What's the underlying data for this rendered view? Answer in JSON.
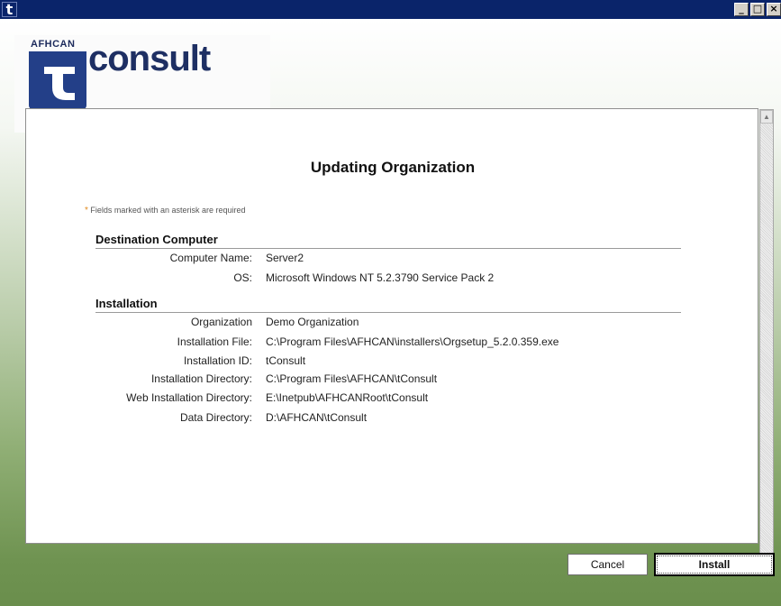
{
  "window": {
    "min_label": "_",
    "max_label": "□",
    "close_label": "×",
    "app_icon_label": "t"
  },
  "logo": {
    "brand": "AFHCAN",
    "product": "consult"
  },
  "page": {
    "title": "Updating Organization",
    "required_star": "*",
    "required_note": "Fields marked with an asterisk are required"
  },
  "destination": {
    "title": "Destination Computer",
    "rows": [
      {
        "label": "Computer Name:",
        "value": "Server2"
      },
      {
        "label": "OS:",
        "value": "Microsoft Windows NT 5.2.3790 Service Pack 2"
      }
    ]
  },
  "installation": {
    "title": "Installation",
    "rows": [
      {
        "label": "Organization",
        "value": "Demo Organization"
      },
      {
        "label": "Installation File:",
        "value": "C:\\Program Files\\AFHCAN\\installers\\Orgsetup_5.2.0.359.exe"
      },
      {
        "label": "Installation ID:",
        "value": "tConsult"
      },
      {
        "label": "Installation Directory:",
        "value": "C:\\Program Files\\AFHCAN\\tConsult"
      },
      {
        "label": "Web Installation Directory:",
        "value": "E:\\Inetpub\\AFHCANRoot\\tConsult"
      },
      {
        "label": "Data Directory:",
        "value": "D:\\AFHCAN\\tConsult"
      }
    ]
  },
  "buttons": {
    "cancel": "Cancel",
    "install": "Install"
  },
  "colors": {
    "titlebar": "#0a246a",
    "logo_blue": "#233f88",
    "accent_orange": "#e18a1f"
  }
}
